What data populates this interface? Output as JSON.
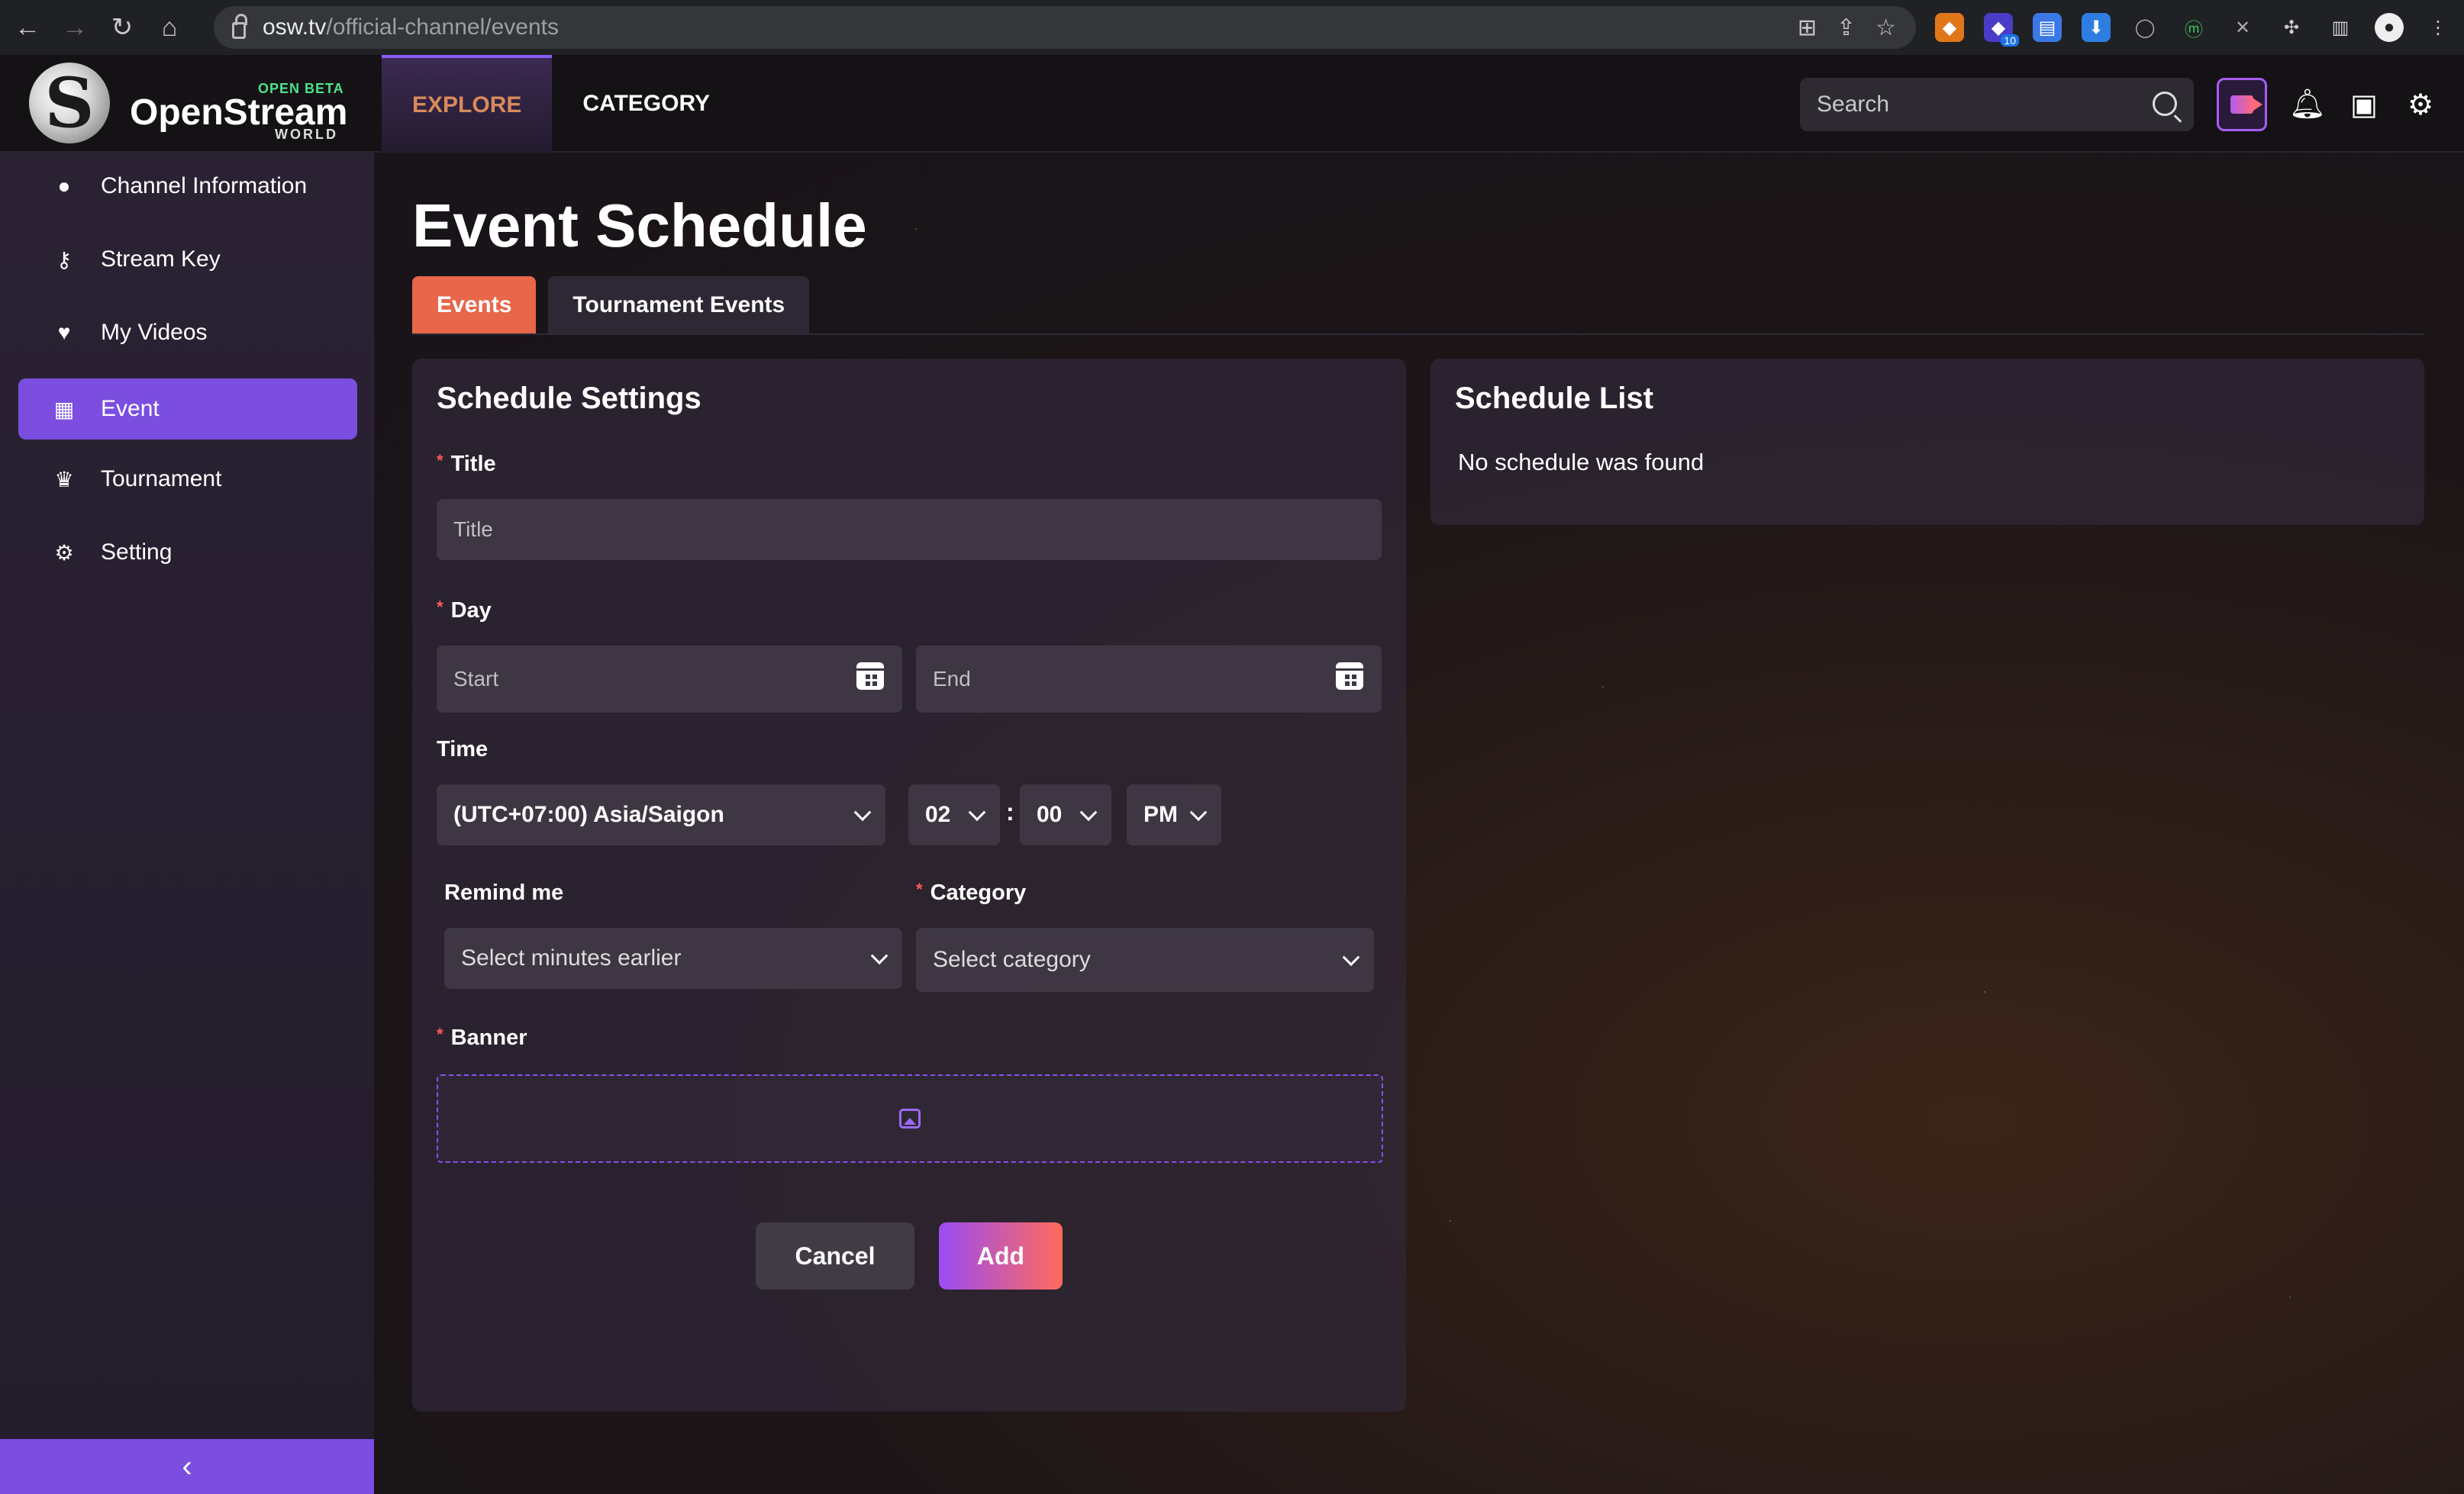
{
  "browser": {
    "url_domain": "osw.tv",
    "url_path": "/official-channel/events",
    "extension_badge": "10"
  },
  "header": {
    "logo_letter": "S",
    "logo_beta": "OPEN BETA",
    "logo_name": "OpenStream",
    "logo_world": "WORLD",
    "nav": [
      {
        "label": "EXPLORE",
        "active": true
      },
      {
        "label": "CATEGORY",
        "active": false
      }
    ],
    "search_placeholder": "Search"
  },
  "sidebar": {
    "items": [
      {
        "label": "Channel Information",
        "icon": "user-icon",
        "active": false
      },
      {
        "label": "Stream Key",
        "icon": "key-icon",
        "active": false
      },
      {
        "label": "My Videos",
        "icon": "heart-icon",
        "active": false
      },
      {
        "label": "Event",
        "icon": "calendar-icon",
        "active": true
      },
      {
        "label": "Tournament",
        "icon": "trophy-icon",
        "active": false
      },
      {
        "label": "Setting",
        "icon": "gear-icon",
        "active": false
      }
    ],
    "collapse_symbol": "‹"
  },
  "main": {
    "title": "Event Schedule",
    "tabs": [
      {
        "label": "Events",
        "active": true
      },
      {
        "label": "Tournament Events",
        "active": false
      }
    ]
  },
  "schedule_settings": {
    "heading": "Schedule Settings",
    "title_label": "Title",
    "title_placeholder": "Title",
    "day_label": "Day",
    "start_placeholder": "Start",
    "end_placeholder": "End",
    "time_label": "Time",
    "timezone": "(UTC+07:00) Asia/Saigon",
    "hour": "02",
    "time_separator": ":",
    "minute": "00",
    "ampm": "PM",
    "remind_label": "Remind me",
    "remind_placeholder": "Select minutes earlier",
    "category_label": "Category",
    "category_placeholder": "Select category",
    "banner_label": "Banner",
    "required_mark": "*",
    "cancel_label": "Cancel",
    "add_label": "Add"
  },
  "schedule_list": {
    "heading": "Schedule List",
    "empty_text": "No schedule was found"
  },
  "colors": {
    "accent_purple": "#7b4ee0",
    "tab_active": "#e8664a",
    "explore_text": "#d98a5c",
    "required": "#ff5b5b"
  }
}
